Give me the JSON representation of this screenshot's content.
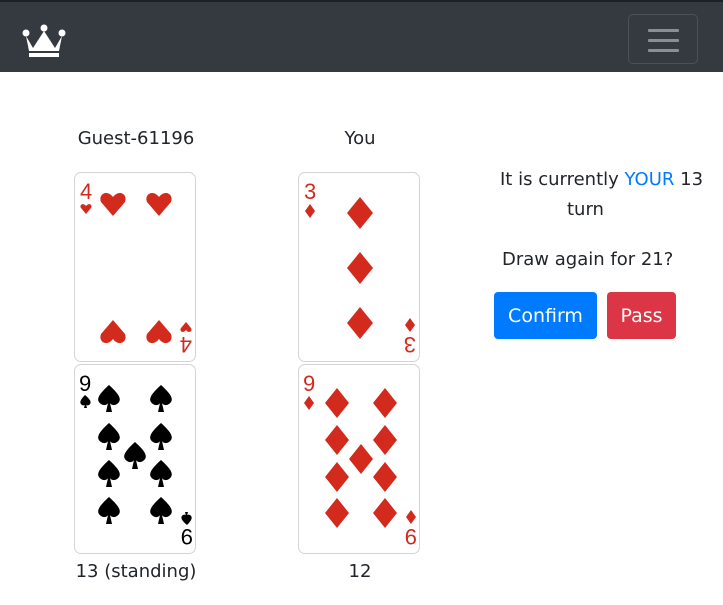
{
  "navbar": {
    "brand_icon": "crown-icon",
    "toggle_icon": "hamburger-menu-icon"
  },
  "players": [
    {
      "name": "Guest-61196",
      "cards": [
        {
          "rank": "4",
          "suit": "hearts"
        },
        {
          "rank": "9",
          "suit": "spades"
        }
      ],
      "score": "13 (standing)"
    },
    {
      "name": "You",
      "cards": [
        {
          "rank": "3",
          "suit": "diamonds"
        },
        {
          "rank": "9",
          "suit": "diamonds"
        }
      ],
      "score": "12"
    }
  ],
  "status": {
    "prefix": "It is currently",
    "highlight": "YOUR",
    "suffix": "13",
    "line2": "turn",
    "question": "Draw again for 21?"
  },
  "buttons": {
    "confirm": "Confirm",
    "pass": "Pass"
  },
  "colors": {
    "red_suit": "#d22b1e",
    "black_suit": "#000000",
    "primary": "#007bff",
    "danger": "#dc3545",
    "navbar": "#343a40"
  }
}
